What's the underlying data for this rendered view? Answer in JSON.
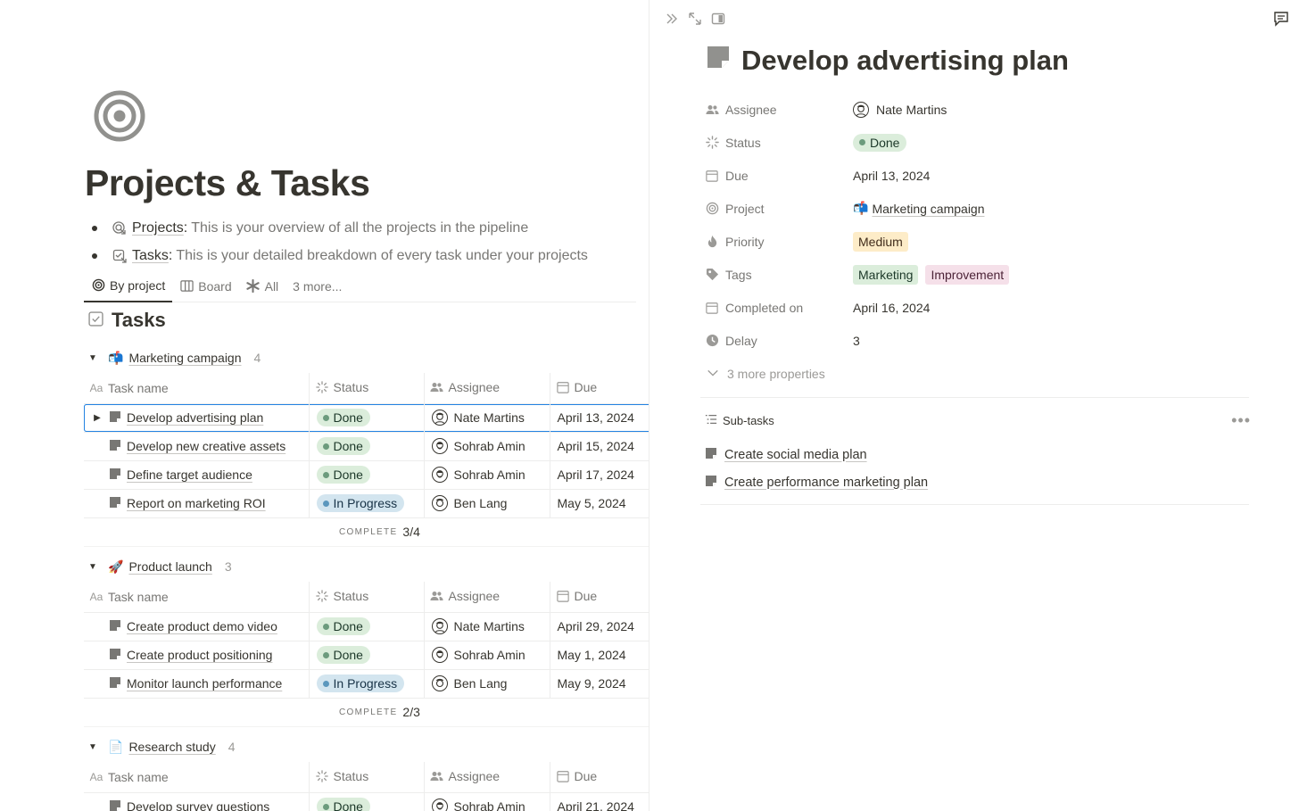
{
  "page": {
    "title": "Projects & Tasks",
    "bullets": [
      {
        "link": "Projects",
        "text": "This is your overview of all the projects in the pipeline"
      },
      {
        "link": "Tasks",
        "text": "This is your detailed breakdown of every task under your projects"
      }
    ]
  },
  "views": {
    "by_project": "By project",
    "board": "Board",
    "all": "All",
    "more": "3 more..."
  },
  "database": {
    "title": "Tasks",
    "columns": {
      "name": "Task name",
      "status": "Status",
      "assignee": "Assignee",
      "due": "Due"
    },
    "complete_label": "COMPLETE",
    "groups": [
      {
        "emoji": "📬",
        "name": "Marketing campaign",
        "count": "4",
        "complete": "3/4",
        "rows": [
          {
            "name": "Develop advertising plan",
            "status": "Done",
            "assignee": "Nate Martins",
            "due": "April 13, 2024"
          },
          {
            "name": "Develop new creative assets",
            "status": "Done",
            "assignee": "Sohrab Amin",
            "due": "April 15, 2024"
          },
          {
            "name": "Define target audience",
            "status": "Done",
            "assignee": "Sohrab Amin",
            "due": "April 17, 2024"
          },
          {
            "name": "Report on marketing ROI",
            "status": "In Progress",
            "assignee": "Ben Lang",
            "due": "May 5, 2024"
          }
        ]
      },
      {
        "emoji": "🚀",
        "name": "Product launch",
        "count": "3",
        "complete": "2/3",
        "rows": [
          {
            "name": "Create product demo video",
            "status": "Done",
            "assignee": "Nate Martins",
            "due": "April 29, 2024"
          },
          {
            "name": "Create product positioning",
            "status": "Done",
            "assignee": "Sohrab Amin",
            "due": "May 1, 2024"
          },
          {
            "name": "Monitor launch performance",
            "status": "In Progress",
            "assignee": "Ben Lang",
            "due": "May 9, 2024"
          }
        ]
      },
      {
        "emoji": "📄",
        "name": "Research study",
        "count": "4",
        "rows": [
          {
            "name": "Develop survey questions",
            "status": "Done",
            "assignee": "Sohrab Amin",
            "due": "April 21, 2024"
          }
        ]
      }
    ]
  },
  "peek": {
    "title": "Develop advertising plan",
    "props": {
      "assignee_label": "Assignee",
      "assignee": "Nate Martins",
      "status_label": "Status",
      "status": "Done",
      "due_label": "Due",
      "due": "April 13, 2024",
      "project_label": "Project",
      "project_emoji": "📬",
      "project": "Marketing campaign",
      "priority_label": "Priority",
      "priority": "Medium",
      "tags_label": "Tags",
      "tag1": "Marketing",
      "tag2": "Improvement",
      "completed_label": "Completed on",
      "completed": "April 16, 2024",
      "delay_label": "Delay",
      "delay": "3"
    },
    "more_props": "3 more properties",
    "subtasks_label": "Sub-tasks",
    "subtasks": [
      "Create social media plan",
      "Create performance marketing plan"
    ]
  },
  "colors": {
    "done_bg": "#dbeddb",
    "progress_bg": "#d3e5ef",
    "selection": "#2383e2",
    "medium_bg": "#fdecc8",
    "improvement_bg": "#f5e0e9"
  },
  "icons": [
    "target-icon",
    "page-icon",
    "checkbox-icon",
    "assignee-icon",
    "status-icon",
    "calendar-icon",
    "priority-icon",
    "tag-icon",
    "clock-icon",
    "chevron-down-icon",
    "list-icon",
    "comment-icon",
    "double-chevron-icon",
    "expand-icon",
    "side-panel-icon"
  ]
}
